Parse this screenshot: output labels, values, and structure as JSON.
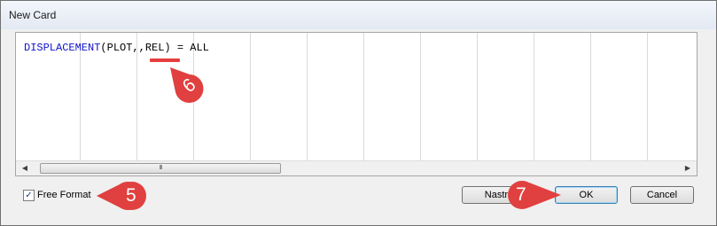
{
  "window": {
    "title": "New Card"
  },
  "editor": {
    "keyword": "DISPLACEMENT",
    "rest": "(PLOT,,REL) = ALL"
  },
  "scrollbar": {
    "left_arrow": "◀",
    "right_arrow": "▶",
    "thumb_grip": "III"
  },
  "free_format": {
    "label": "Free Format",
    "checked": true,
    "check_mark": "✓"
  },
  "buttons": {
    "apply_label": "Nastra",
    "ok_label": "OK",
    "cancel_label": "Cancel"
  },
  "annotations": {
    "callout_5": "5",
    "callout_6": "6",
    "callout_7": "7",
    "color": "#e53e3e"
  }
}
